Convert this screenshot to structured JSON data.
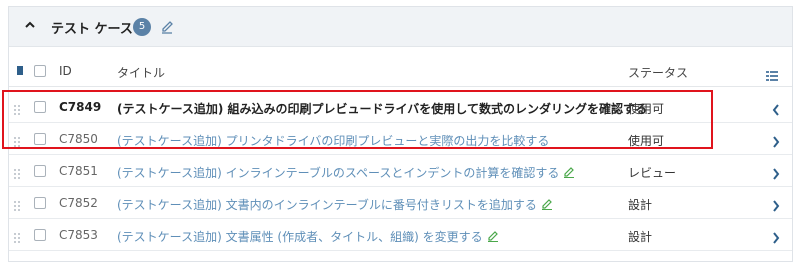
{
  "section": {
    "title": "テスト ケース",
    "count": "5",
    "toggle_icon": "chevron-up-icon",
    "edit_icon": "pencil-icon"
  },
  "columns": {
    "id": "ID",
    "title": "タイトル",
    "status": "ステータス"
  },
  "rows": [
    {
      "id": "C7849",
      "title": "(テストケース追加) 組み込みの印刷プレビュードライバを使用して数式のレンダリングを確認する",
      "status": "使用可",
      "active": true,
      "editable": false
    },
    {
      "id": "C7850",
      "title": "(テストケース追加) プリンタドライバの印刷プレビューと実際の出力を比較する",
      "status": "使用可",
      "active": false,
      "editable": false
    },
    {
      "id": "C7851",
      "title": "(テストケース追加) インラインテーブルのスペースとインデントの計算を確認する",
      "status": "レビュー",
      "active": false,
      "editable": true
    },
    {
      "id": "C7852",
      "title": "(テストケース追加) 文書内のインラインテーブルに番号付きリストを追加する",
      "status": "設計",
      "active": false,
      "editable": true
    },
    {
      "id": "C7853",
      "title": "(テストケース追加) 文書属性 (作成者、タイトル、組織) を変更する",
      "status": "設計",
      "active": false,
      "editable": true
    }
  ],
  "colors": {
    "highlight": "#e0141d",
    "badge": "#5b82a7",
    "link": "#5f8fb8",
    "header_bg": "#f0f3f6"
  }
}
